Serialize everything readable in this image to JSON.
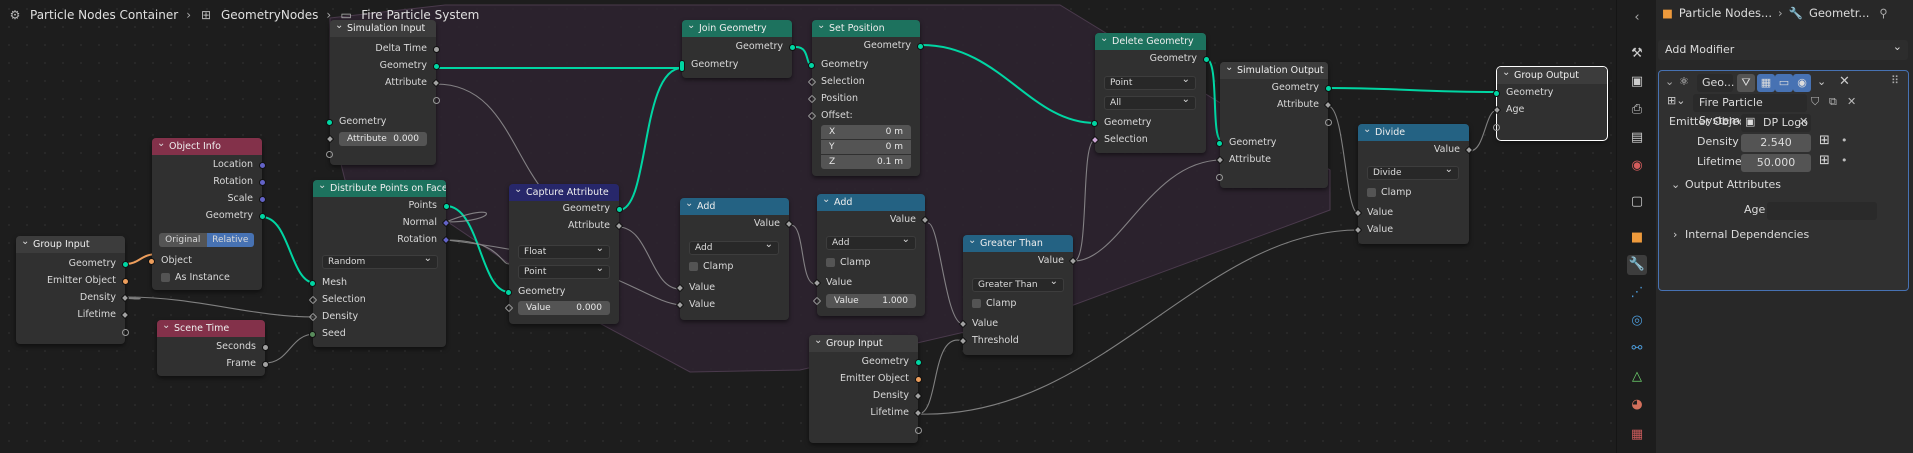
{
  "breadcrumb": {
    "items": [
      "Particle Nodes Container",
      "GeometryNodes",
      "Fire Particle System"
    ]
  },
  "nodes": {
    "sim_input": {
      "title": "Simulation Input",
      "outputs": [
        "Delta Time",
        "Geometry",
        "Attribute"
      ],
      "inputs": [
        "Geometry"
      ],
      "attr_label": "Attribute",
      "attr_value": "0.000"
    },
    "object_info": {
      "title": "Object Info",
      "outputs": [
        "Location",
        "Rotation",
        "Scale",
        "Geometry"
      ],
      "seg": [
        "Original",
        "Relative"
      ],
      "inputs": [
        "Object",
        "As Instance"
      ]
    },
    "group_input_left": {
      "title": "Group Input",
      "outputs": [
        "Geometry",
        "Emitter Object",
        "Density",
        "Lifetime"
      ]
    },
    "scene_time": {
      "title": "Scene Time",
      "outputs": [
        "Seconds",
        "Frame"
      ]
    },
    "distribute": {
      "title": "Distribute Points on Faces",
      "outputs": [
        "Points",
        "Normal",
        "Rotation"
      ],
      "mode": "Random",
      "inputs": [
        "Mesh",
        "Selection",
        "Density",
        "Seed"
      ]
    },
    "capture": {
      "title": "Capture Attribute",
      "outputs": [
        "Geometry",
        "Attribute"
      ],
      "type": "Float",
      "domain": "Point",
      "inputs": [
        "Geometry"
      ],
      "value_label": "Value",
      "value": "0.000"
    },
    "join": {
      "title": "Join Geometry",
      "outputs": [
        "Geometry"
      ],
      "inputs": [
        "Geometry"
      ]
    },
    "set_position": {
      "title": "Set Position",
      "outputs": [
        "Geometry"
      ],
      "inputs": [
        "Geometry",
        "Selection",
        "Position",
        "Offset:"
      ],
      "offset": [
        {
          "k": "X",
          "v": "0 m"
        },
        {
          "k": "Y",
          "v": "0 m"
        },
        {
          "k": "Z",
          "v": "0.1 m"
        }
      ]
    },
    "add1": {
      "title": "Add",
      "outputs": [
        "Value"
      ],
      "op": "Add",
      "clamp": "Clamp",
      "inputs": [
        "Value",
        "Value"
      ]
    },
    "add2": {
      "title": "Add",
      "outputs": [
        "Value"
      ],
      "op": "Add",
      "clamp": "Clamp",
      "inputs": [
        "Value"
      ],
      "value_label": "Value",
      "value": "1.000"
    },
    "group_input_mid": {
      "title": "Group Input",
      "outputs": [
        "Geometry",
        "Emitter Object",
        "Density",
        "Lifetime"
      ]
    },
    "greater": {
      "title": "Greater Than",
      "outputs": [
        "Value"
      ],
      "op": "Greater Than",
      "clamp": "Clamp",
      "inputs": [
        "Value",
        "Threshold"
      ]
    },
    "delete": {
      "title": "Delete Geometry",
      "outputs": [
        "Geometry"
      ],
      "domain": "Point",
      "mode": "All",
      "inputs": [
        "Geometry",
        "Selection"
      ]
    },
    "sim_output": {
      "title": "Simulation Output",
      "outputs": [
        "Geometry",
        "Attribute"
      ],
      "inputs": [
        "Geometry",
        "Attribute"
      ]
    },
    "divide": {
      "title": "Divide",
      "outputs": [
        "Value"
      ],
      "op": "Divide",
      "clamp": "Clamp",
      "inputs": [
        "Value",
        "Value"
      ]
    },
    "group_output": {
      "title": "Group Output",
      "inputs": [
        "Geometry",
        "Age"
      ]
    }
  },
  "properties": {
    "breadcrumb": [
      "Particle Nodes...",
      "Geometr..."
    ],
    "add_modifier": "Add Modifier",
    "modifier_name": "Geo...",
    "node_group": "Fire Particle System",
    "emitter_label": "Emitter Object",
    "emitter_value": "DP Logo",
    "density_label": "Density",
    "density_value": "2.540",
    "lifetime_label": "Lifetime",
    "lifetime_value": "50.000",
    "output_attrs": "Output Attributes",
    "age_label": "Age",
    "age_value": "",
    "internal": "Internal Dependencies"
  },
  "colors": {
    "geometry_socket": "#00d6a3",
    "selection_accent": "#4772b3",
    "geo_header": "#1d725e",
    "input_header": "#83314a",
    "attr_header": "#27276a",
    "util_header": "#246283"
  }
}
